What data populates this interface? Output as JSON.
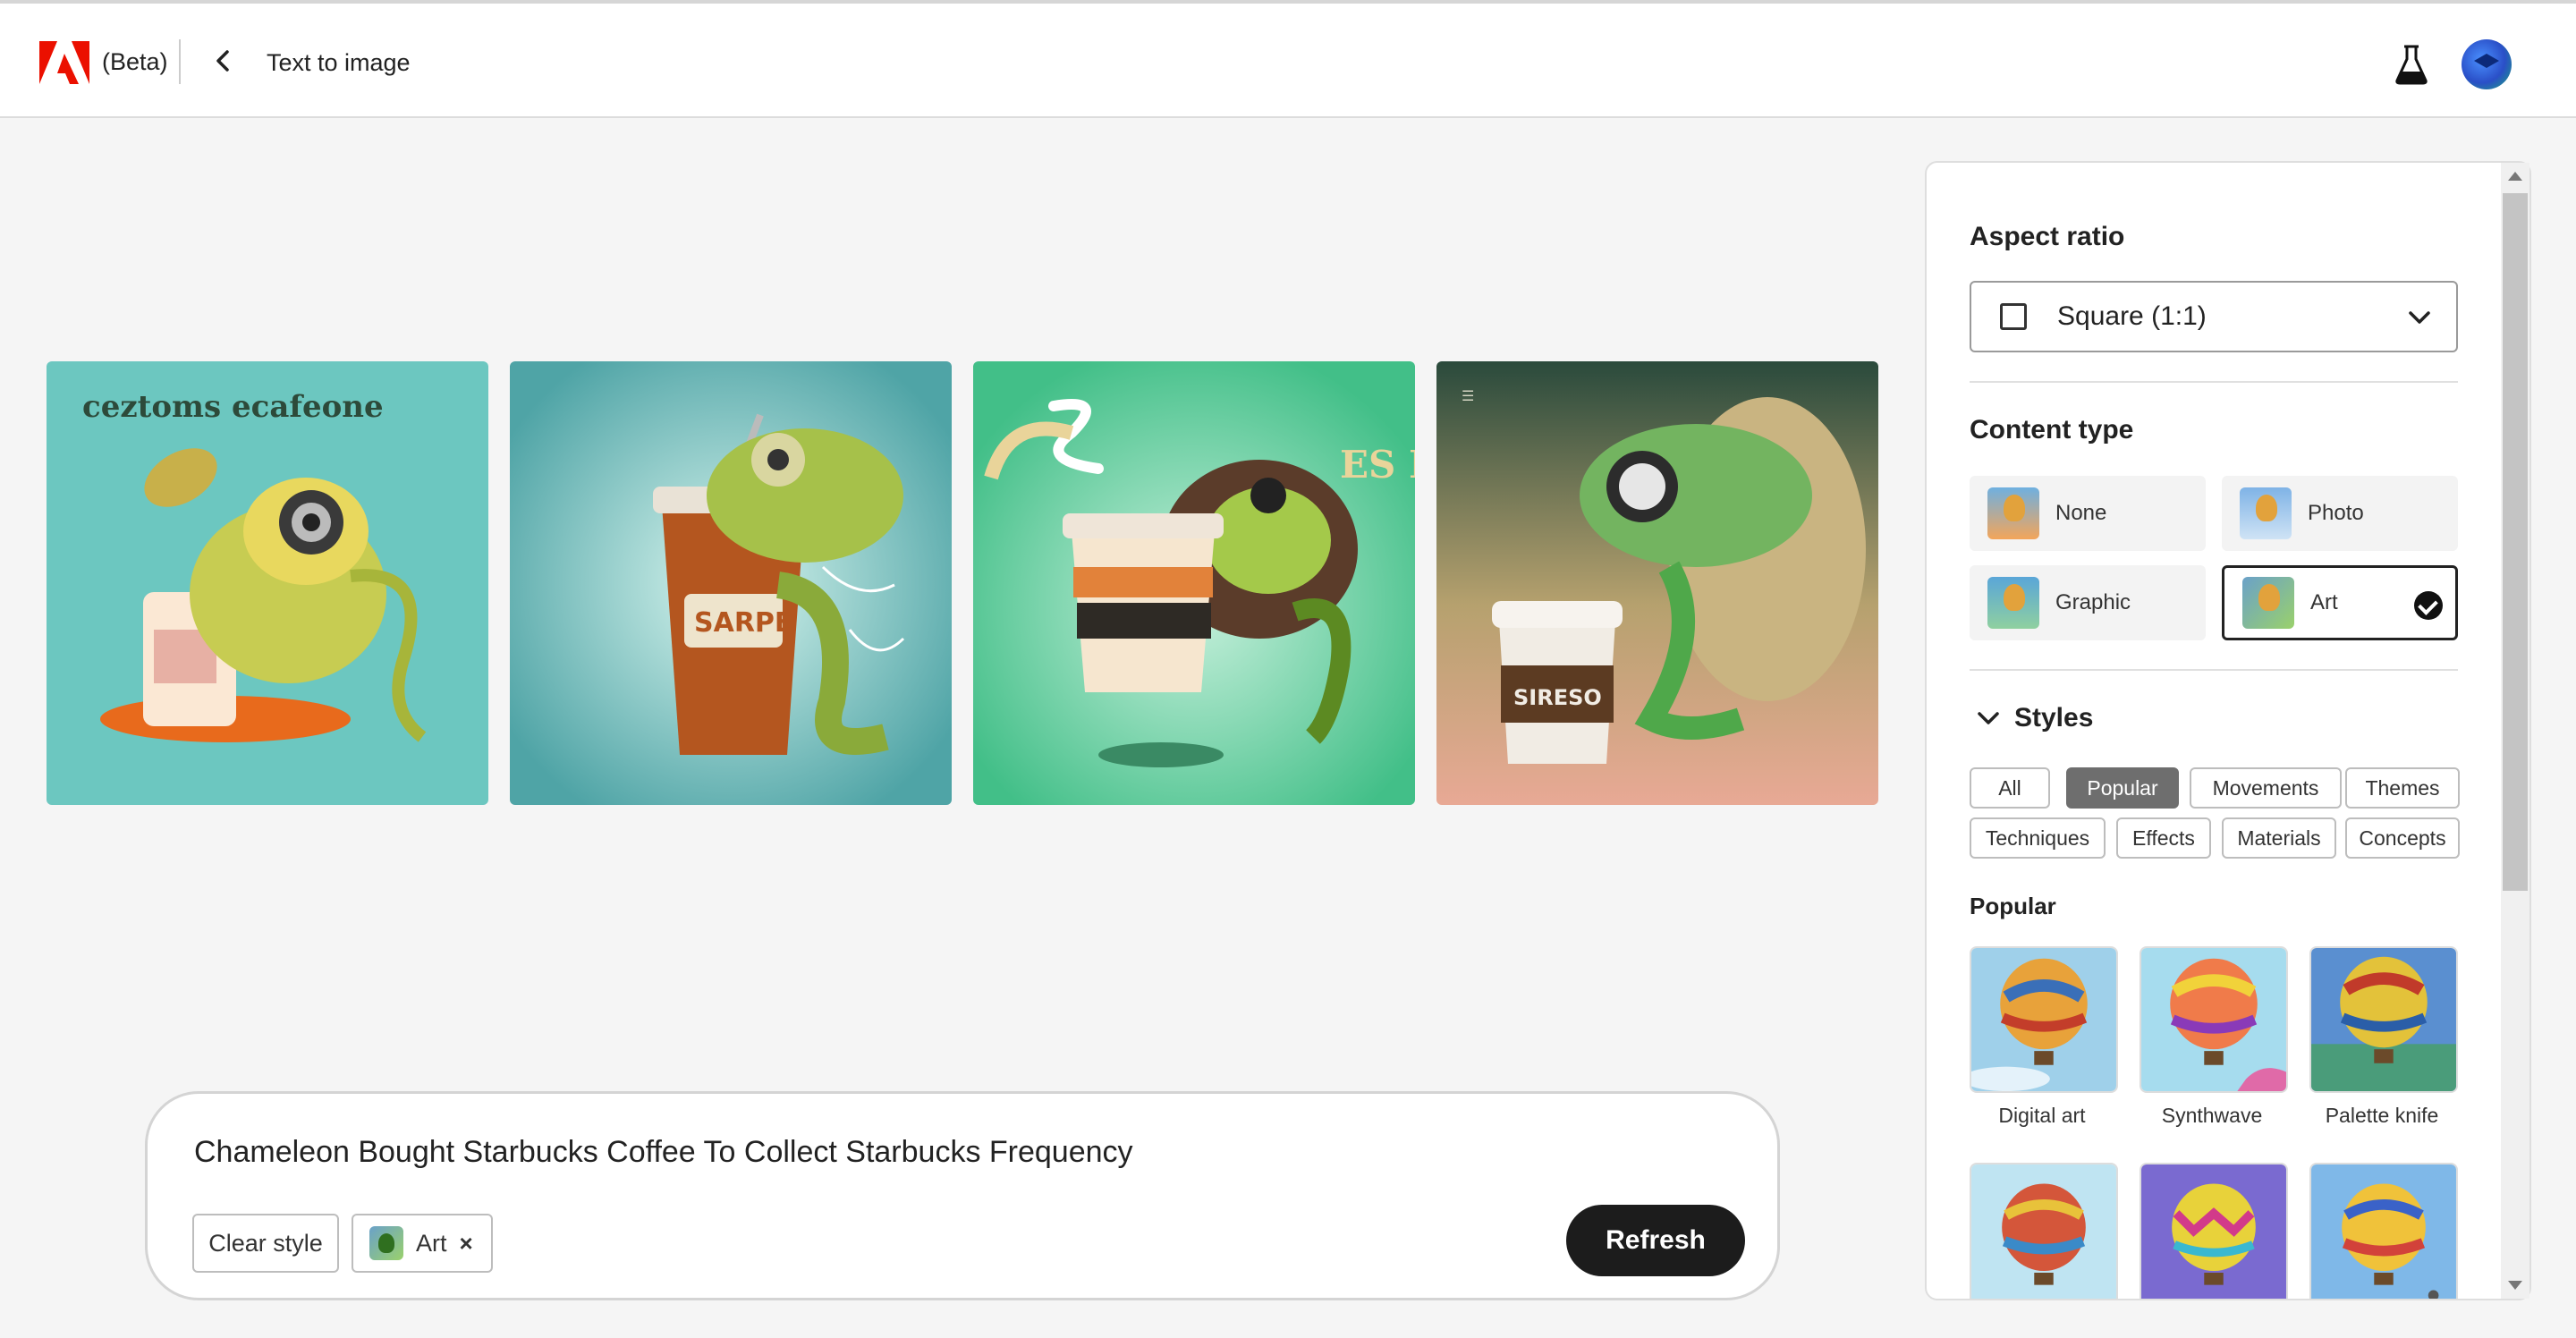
{
  "header": {
    "beta_label": "(Beta)",
    "title": "Text to image",
    "brand_color": "#eb1000"
  },
  "images": [
    {
      "name": "generated-image-1",
      "caption": "ceztoms ecafeone"
    },
    {
      "name": "generated-image-2",
      "caption": "SARPE"
    },
    {
      "name": "generated-image-3",
      "caption": "ES PEE E"
    },
    {
      "name": "generated-image-4",
      "caption": "SIRESO"
    }
  ],
  "prompt": {
    "text": "Chameleon Bought Starbucks Coffee To Collect Starbucks Frequency",
    "clear_style_label": "Clear style",
    "style_chip_label": "Art",
    "style_chip_remove": "×",
    "refresh_label": "Refresh"
  },
  "panel": {
    "aspect_ratio": {
      "title": "Aspect ratio",
      "selected": "Square (1:1)"
    },
    "content_type": {
      "title": "Content type",
      "options": [
        {
          "label": "None",
          "selected": false
        },
        {
          "label": "Photo",
          "selected": false
        },
        {
          "label": "Graphic",
          "selected": false
        },
        {
          "label": "Art",
          "selected": true
        }
      ]
    },
    "styles": {
      "title": "Styles",
      "filters": [
        {
          "label": "All",
          "active": false
        },
        {
          "label": "Popular",
          "active": true
        },
        {
          "label": "Movements",
          "active": false
        },
        {
          "label": "Themes",
          "active": false
        },
        {
          "label": "Techniques",
          "active": false
        },
        {
          "label": "Effects",
          "active": false
        },
        {
          "label": "Materials",
          "active": false
        },
        {
          "label": "Concepts",
          "active": false
        }
      ],
      "section_title": "Popular",
      "tiles": [
        {
          "label": "Digital art"
        },
        {
          "label": "Synthwave"
        },
        {
          "label": "Palette knife"
        }
      ]
    }
  }
}
